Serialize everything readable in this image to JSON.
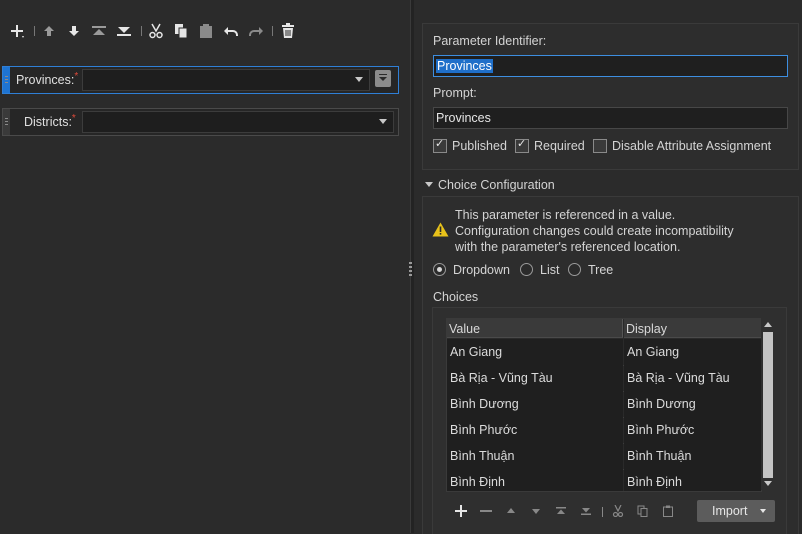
{
  "toolbar": {
    "icons": [
      "add-icon",
      "move-up-icon",
      "move-down-icon",
      "move-top-icon",
      "move-bottom-icon",
      "cut-icon",
      "copy-icon",
      "paste-icon",
      "undo-icon",
      "redo-icon",
      "delete-icon"
    ]
  },
  "parameters": [
    {
      "label": "Provinces:",
      "required": true,
      "selected": true,
      "value": ""
    },
    {
      "label": "Districts:",
      "required": true,
      "selected": false,
      "value": ""
    }
  ],
  "details": {
    "identifier_label": "Parameter Identifier:",
    "identifier_value": "Provinces",
    "prompt_label": "Prompt:",
    "prompt_value": "Provinces",
    "checkboxes": [
      {
        "label": "Published",
        "checked": true
      },
      {
        "label": "Required",
        "checked": true
      },
      {
        "label": "Disable Attribute Assignment",
        "checked": false
      }
    ]
  },
  "choice_config": {
    "header": "Choice Configuration",
    "warning_lines": [
      "This parameter is referenced in a value.",
      "Configuration changes could create incompatibility",
      "with the parameter's referenced location."
    ],
    "radio_options": [
      {
        "label": "Dropdown",
        "selected": true
      },
      {
        "label": "List",
        "selected": false
      },
      {
        "label": "Tree",
        "selected": false
      }
    ],
    "choices_label": "Choices",
    "columns": [
      "Value",
      "Display"
    ],
    "rows": [
      [
        "An Giang",
        "An Giang"
      ],
      [
        "Bà Rịa - Vũng Tàu",
        "Bà Rịa - Vũng Tàu"
      ],
      [
        "Bình Dương",
        "Bình Dương"
      ],
      [
        "Bình Phước",
        "Bình Phước"
      ],
      [
        "Bình Thuận",
        "Bình Thuận"
      ],
      [
        "Bình Định",
        "Bình Định"
      ]
    ],
    "import_label": "Import"
  },
  "colors": {
    "background": "#2b2b2b",
    "selection_accent": "#1e74d2",
    "required_star": "#e04a3a"
  }
}
